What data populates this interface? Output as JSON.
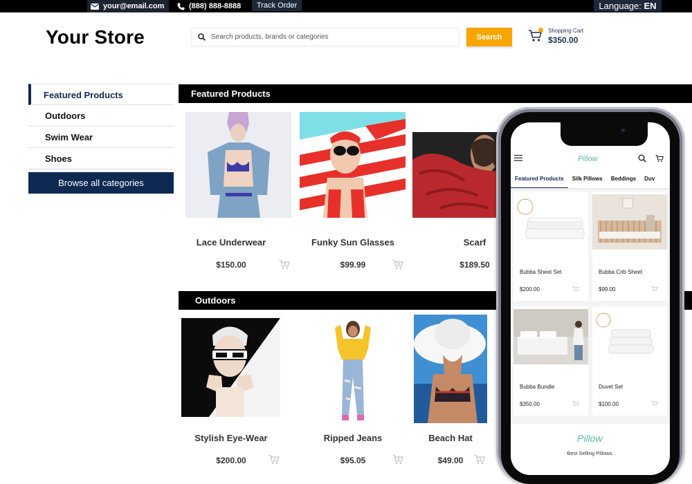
{
  "topbar": {
    "email": "your@email.com",
    "phone": "(888) 888-8888",
    "track_order": "Track Order",
    "language_label": "Language:",
    "language_value": "EN"
  },
  "header": {
    "store_title": "Your Store",
    "search_placeholder": "Search products, brands or categories",
    "search_button": "Search",
    "cart_label": "Shopping Cart",
    "cart_total": "$350.00"
  },
  "sidebar": {
    "items": [
      {
        "label": "Featured Products"
      },
      {
        "label": "Outdoors"
      },
      {
        "label": "Swim Wear"
      },
      {
        "label": "Shoes"
      }
    ],
    "browse_button": "Browse all categories"
  },
  "sections": {
    "featured": {
      "title": "Featured Products",
      "products": [
        {
          "name": "Lace Underwear",
          "price": "$150.00"
        },
        {
          "name": "Funky Sun Glasses",
          "price": "$99.99"
        },
        {
          "name": "Scarf",
          "price": "$189.50"
        }
      ]
    },
    "outdoors": {
      "title": "Outdoors",
      "products": [
        {
          "name": "Stylish Eye-Wear",
          "price": "$200.00"
        },
        {
          "name": "Ripped Jeans",
          "price": "$95.05"
        },
        {
          "name": "Beach Hat",
          "price": "$49.00"
        }
      ]
    }
  },
  "mobile": {
    "logo": "Pillow",
    "tabs": [
      "Featured Products",
      "Silk Pillows",
      "Beddings",
      "Duv"
    ],
    "products": [
      {
        "name": "Bubba Sheet Set",
        "price": "$200.00"
      },
      {
        "name": "Bubba Crib Sheet",
        "price": "$99.00"
      },
      {
        "name": "Bubba Bundle",
        "price": "$350.00"
      },
      {
        "name": "Duvet Set",
        "price": "$100.00"
      }
    ],
    "footer_logo": "Pillow",
    "footer_text": "Best Selling Pillows."
  },
  "colors": {
    "brand_navy": "#0e2a52",
    "accent_orange": "#f9a602",
    "topbar_black": "#000000",
    "pillow_teal": "#5ab4a9"
  }
}
